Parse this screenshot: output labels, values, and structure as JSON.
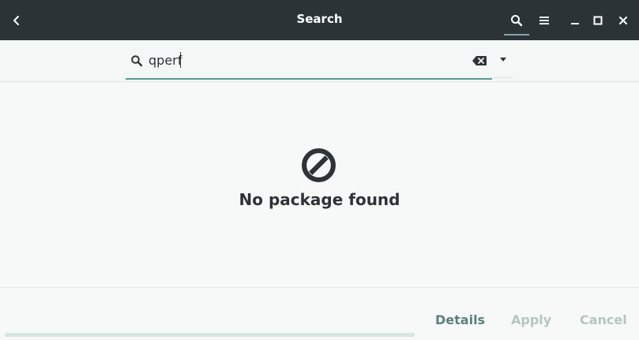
{
  "titlebar": {
    "title": "Search",
    "back_icon": "chevron-left-icon",
    "search_icon": "search-icon",
    "menu_icon": "hamburger-menu-icon",
    "minimize_icon": "minimize-icon",
    "maximize_icon": "maximize-icon",
    "close_icon": "close-icon"
  },
  "search": {
    "query": "qperf",
    "icon": "search-icon",
    "clear_icon": "backspace-clear-icon",
    "dropdown_icon": "dropdown-arrow-icon"
  },
  "content": {
    "empty_icon": "no-entry-icon",
    "empty_message": "No package found"
  },
  "footer": {
    "progress_fraction": 0,
    "details_label": "Details",
    "apply_label": "Apply",
    "cancel_label": "Cancel"
  },
  "colors": {
    "titlebar_bg": "#2b3336",
    "accent": "#5d9b93",
    "disabled_text": "#b6c4c2",
    "text": "#2e3436"
  }
}
